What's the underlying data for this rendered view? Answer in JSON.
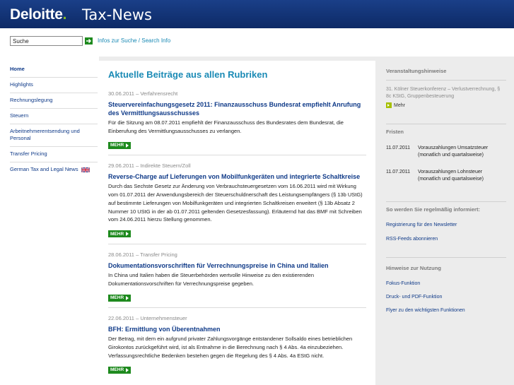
{
  "header": {
    "logo_text": "Deloitte",
    "logo_dot": ".",
    "title": "Tax-News"
  },
  "search": {
    "value": "Suche",
    "info_link": "Infos zur Suche / Search Info"
  },
  "colors": {
    "header_blue": "#14357a",
    "link_blue": "#0f3a88",
    "title_teal": "#1a8ab5",
    "button_green": "#1e8a1e",
    "accent_lime": "#a6c000"
  },
  "sidebar": {
    "items": [
      {
        "label": "Home"
      },
      {
        "label": "Highlights"
      },
      {
        "label": "Rechnungslegung"
      },
      {
        "label": "Steuern"
      },
      {
        "label": "Arbeitnehmerentsendung und Personal"
      },
      {
        "label": "Transfer Pricing"
      },
      {
        "label": "German Tax and Legal News",
        "icon": "uk-flag-icon"
      }
    ]
  },
  "main": {
    "title": "Aktuelle Beiträge aus allen Rubriken",
    "more_label": "MEHR",
    "articles": [
      {
        "meta": "30.06.2011 – Verfahrensrecht",
        "title": "Steuervereinfachungsgesetz 2011: Finanzausschuss Bundesrat empfiehlt Anrufung des Vermittlungsausschusses",
        "body": "Für die Sitzung am 08.07.2011 empfiehlt der Finanzausschuss des Bundesrates dem Bundesrat, die Einberufung des Vermittlungsausschusses zu verlangen."
      },
      {
        "meta": "29.06.2011 – Indirekte Steuern/Zoll",
        "title": "Reverse-Charge auf Lieferungen von Mobilfunkgeräten und integrierte Schaltkreise",
        "body": "Durch das Sechste Gesetz zur Änderung von Verbrauchsteuergesetzen vom 16.06.2011 wird mit Wirkung vom 01.07.2011 der Anwendungsbereich der Steuerschuldnerschaft des Leistungsempfängers (§ 13b UStG) auf bestimmte Lieferungen von Mobilfunkgeräten und integrierten Schaltkreisen erweitert (§ 13b Absatz 2 Nummer 10 UStG in der ab 01.07.2011 geltenden Gesetzesfassung). Erläuternd hat das BMF mit Schreiben vom 24.06.2011 hierzu Stellung genommen."
      },
      {
        "meta": "28.06.2011 – Transfer Pricing",
        "title": "Dokumentationsvorschriften für Verrechnungspreise in China und Italien",
        "body": "In China und Italien haben die Steuerbehörden wertvolle Hinweise zu den existierenden Dokumentationsvorschriften für Verrechnungspreise gegeben."
      },
      {
        "meta": "22.06.2011 – Unternehmensteuer",
        "title": "BFH: Ermittlung von Überentnahmen",
        "body": "Der Betrag, mit dem ein aufgrund privater Zahlungsvorgänge entstandener Sollsaldo eines betrieblichen Girokontos zurückgeführt wird, ist als Entnahme in die Berechnung nach § 4 Abs. 4a einzubeziehen. Verfassungsrechtliche Bedenken bestehen gegen die Regelung des § 4 Abs. 4a EStG nicht."
      }
    ]
  },
  "right": {
    "events": {
      "heading": "Veranstaltungshinweise",
      "text": "31. Kölner Steuerkonferenz – Verlustverrechnung, § 8c KStG, Gruppenbesteuerung",
      "more": "Mehr"
    },
    "fristen": {
      "heading": "Fristen",
      "items": [
        {
          "date": "11.07.2011",
          "text": "Vorauszahlungen Umsatzsteuer (monatlich und quartalsweise)"
        },
        {
          "date": "11.07.2011",
          "text": "Vorauszahlungen Lohnsteuer (monatlich und quartalsweise)"
        }
      ]
    },
    "informed": {
      "heading": "So werden Sie regelmäßig informiert:",
      "links": [
        "Registrierung für den Newsletter",
        "RSS-Feeds abonnieren"
      ]
    },
    "usage": {
      "heading": "Hinweise zur Nutzung",
      "links": [
        "Fokus-Funktion",
        "Druck- und PDF-Funktion",
        "Flyer zu den wichtigsten Funktionen"
      ]
    }
  }
}
